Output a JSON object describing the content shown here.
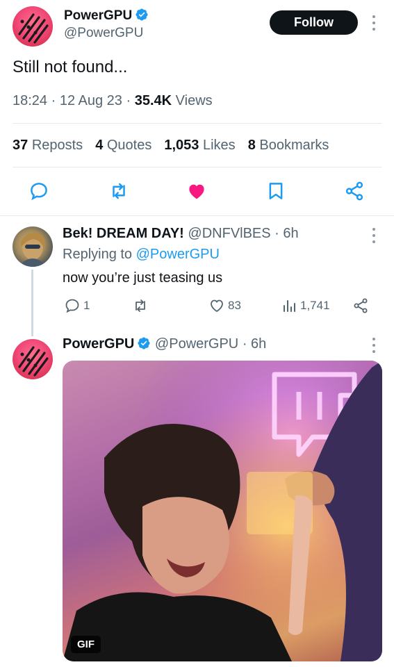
{
  "main_tweet": {
    "author_name": "PowerGPU",
    "author_handle": "@PowerGPU",
    "follow_label": "Follow",
    "text": "Still not found...",
    "time": "18:24",
    "date": "12 Aug 23",
    "views_count": "35.4K",
    "views_label": "Views",
    "stats": {
      "reposts_count": "37",
      "reposts_label": "Reposts",
      "quotes_count": "4",
      "quotes_label": "Quotes",
      "likes_count": "1,053",
      "likes_label": "Likes",
      "bookmarks_count": "8",
      "bookmarks_label": "Bookmarks"
    },
    "liked": true,
    "accent_color": "#1d9bf0",
    "like_color": "#f91880"
  },
  "reply": {
    "author_name": "Bek! DREAM DAY!",
    "author_handle": "@DNFVlBES",
    "time_ago": "6h",
    "replying_prefix": "Replying to",
    "replying_to": "@PowerGPU",
    "text": "now you’re just teasing us",
    "reply_count": "1",
    "like_count": "83",
    "view_count": "1,741"
  },
  "second_tweet": {
    "author_name": "PowerGPU",
    "author_handle": "@PowerGPU",
    "time_ago": "6h",
    "media_badge": "GIF"
  },
  "icons": [
    "verified-badge-icon",
    "more-icon",
    "reply-icon",
    "repost-icon",
    "like-icon",
    "bookmark-icon",
    "share-icon",
    "views-icon"
  ]
}
